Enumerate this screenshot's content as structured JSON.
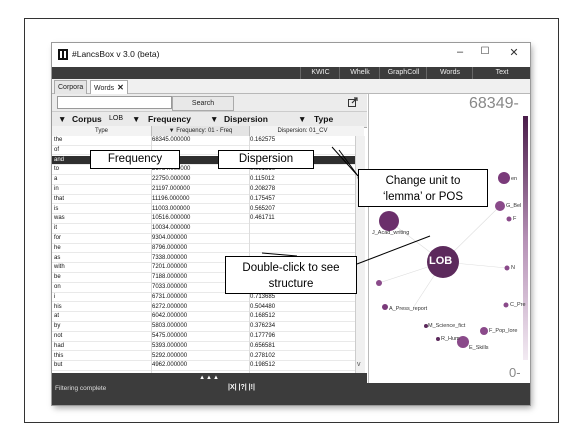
{
  "window": {
    "title": "#LancsBox v 3.0 (beta)",
    "minimize": "–",
    "maximize": "☐",
    "close": "✕"
  },
  "menubar": {
    "items": [
      "KWIC",
      "Whelk",
      "GraphColl",
      "Words",
      "Text"
    ]
  },
  "tabs": {
    "corpora": "Corpora",
    "words": "Words",
    "close_glyph": "✕"
  },
  "search": {
    "value": "",
    "button": "Search"
  },
  "columns": {
    "arrow": "▼",
    "corpus_label": "Corpus",
    "corpus_value": "LOB",
    "frequency": "Frequency",
    "dispersion": "Dispersion",
    "type": "Type",
    "sub_type": "Type",
    "sub_frequency": "▼ Frequency: 01 - Freq",
    "sub_dispersion": "Dispersion: 01_CV"
  },
  "rows": [
    {
      "type": "the",
      "freq": "68345.000000",
      "disp": "0.162575"
    },
    {
      "type": "of",
      "freq": "",
      "disp": ""
    },
    {
      "type": "and",
      "freq": "",
      "disp": ""
    },
    {
      "type": "to",
      "freq": "26784.000000",
      "disp": "0.081516"
    },
    {
      "type": "a",
      "freq": "22750.000000",
      "disp": "0.115012"
    },
    {
      "type": "in",
      "freq": "21197.000000",
      "disp": "0.208278"
    },
    {
      "type": "that",
      "freq": "11196.000000",
      "disp": "0.175457"
    },
    {
      "type": "is",
      "freq": "11003.000000",
      "disp": "0.565207"
    },
    {
      "type": "was",
      "freq": "10516.000000",
      "disp": "0.461711"
    },
    {
      "type": "it",
      "freq": "10034.000000",
      "disp": ""
    },
    {
      "type": "for",
      "freq": "9304.000000",
      "disp": ""
    },
    {
      "type": "he",
      "freq": "8796.000000",
      "disp": ""
    },
    {
      "type": "as",
      "freq": "7338.000000",
      "disp": ""
    },
    {
      "type": "with",
      "freq": "7201.000000",
      "disp": "0.111492"
    },
    {
      "type": "be",
      "freq": "7188.000000",
      "disp": "0.277348"
    },
    {
      "type": "on",
      "freq": "7033.000000",
      "disp": "0.131851"
    },
    {
      "type": "i",
      "freq": "6731.000000",
      "disp": "0.713685"
    },
    {
      "type": "his",
      "freq": "6272.000000",
      "disp": "0.504480"
    },
    {
      "type": "at",
      "freq": "6042.000000",
      "disp": "0.168512"
    },
    {
      "type": "by",
      "freq": "5803.000000",
      "disp": "0.376234"
    },
    {
      "type": "not",
      "freq": "5475.000000",
      "disp": "0.177796"
    },
    {
      "type": "had",
      "freq": "5393.000000",
      "disp": "0.656581"
    },
    {
      "type": "this",
      "freq": "5292.000000",
      "disp": "0.278102"
    },
    {
      "type": "but",
      "freq": "4962.000000",
      "disp": "0.198512"
    }
  ],
  "expand": "▲▲▲",
  "status": {
    "text": "Filtering complete",
    "icons": "|X| |?| |!|"
  },
  "viz": {
    "max_label": "68349-",
    "min_label": "0-",
    "nodes": {
      "lob": "LOB",
      "acad": "J_Acad_writing",
      "press": "A_Press_report",
      "science": "M_Science_fict",
      "pop": "F_Pop_lore",
      "hum": "R_Hum",
      "skills": "E_Skills",
      "cpre": "C_Pre",
      "gbel": "G_Bel",
      "en": "en",
      "nlabel": "N",
      "flabel": "F"
    }
  },
  "callouts": {
    "frequency": "Frequency",
    "dispersion": "Dispersion",
    "change_unit": "Change unit to\n‘lemma’ or POS",
    "double_click": "Double-click to see\nstructure"
  }
}
